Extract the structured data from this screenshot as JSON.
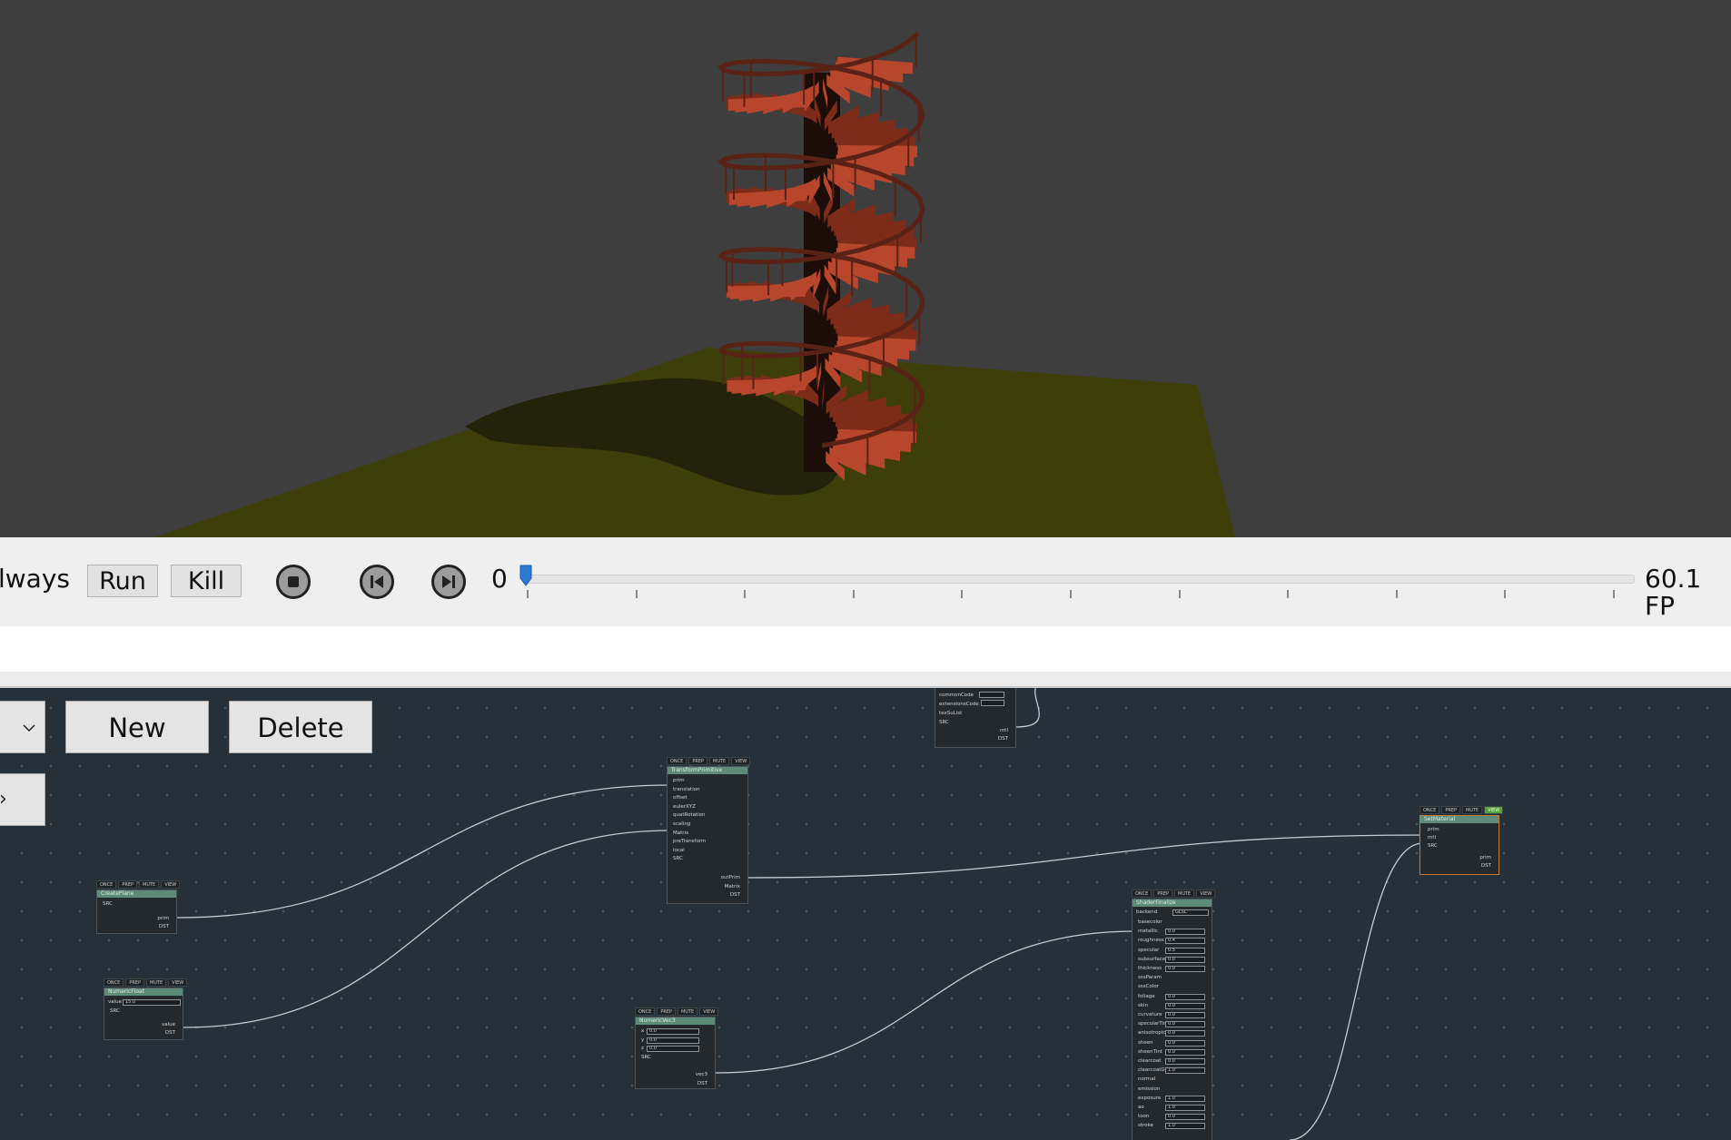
{
  "toolbar": {
    "mode_label": "lways",
    "run_label": "Run",
    "kill_label": "Kill",
    "frame_value": "0",
    "fps_label": "60.1 FP",
    "timeline_fraction": 0.0
  },
  "editor": {
    "new_label": "New",
    "delete_label": "Delete"
  },
  "flags": {
    "once": "ONCE",
    "prep": "PREP",
    "mute": "MUTE",
    "view": "VIEW"
  },
  "nodes": {
    "create_plane": {
      "title": "CreatePlane",
      "inputs": [
        "SRC"
      ],
      "outputs": [
        "prim",
        "DST"
      ]
    },
    "numeric_float": {
      "title": "NumericFloat",
      "inputs": [
        "value",
        "SRC"
      ],
      "value": "15.0",
      "outputs": [
        "value",
        "DST"
      ]
    },
    "transform_primitive": {
      "title": "TransformPrimitive",
      "inputs": [
        "prim",
        "translation",
        "offset",
        "eulerXYZ",
        "quatRotation",
        "scaling",
        "Matrix",
        "preTransform",
        "local",
        "SRC"
      ],
      "outputs": [
        "outPrim",
        "Matrix",
        "DST"
      ]
    },
    "numeric_vec3": {
      "title": "NumericVec3",
      "inputs": [
        "x",
        "y",
        "z",
        "SRC"
      ],
      "values": [
        "0.0",
        "0.0",
        "0.0"
      ],
      "outputs": [
        "vec3",
        "DST"
      ]
    },
    "shader_finalize": {
      "title": "ShaderFinalize",
      "backend_label": "backend",
      "backend_value": "GLSL",
      "inputs": [
        "basecolor",
        "metallic",
        "roughness",
        "specular",
        "subsurface",
        "thickness",
        "sssParam",
        "sssColor",
        "foliage",
        "skin",
        "curvature",
        "specularTint",
        "anisotropic",
        "sheen",
        "sheenTint",
        "clearcoat",
        "clearcoatGloss",
        "normal",
        "emission",
        "exposure",
        "ao",
        "toon",
        "stroke"
      ],
      "values": [
        "",
        "0.0",
        "0.4",
        "0.5",
        "0.0",
        "0.0",
        "",
        "",
        "0.0",
        "0.0",
        "0.0",
        "0.0",
        "0.0",
        "0.0",
        "0.0",
        "0.0",
        "1.0",
        "",
        "",
        "1.0",
        "1.0",
        "0.0",
        "1.0"
      ]
    },
    "set_material": {
      "title": "SetMaterial",
      "inputs": [
        "prim",
        "mtl",
        "SRC"
      ],
      "outputs": [
        "prim",
        "DST"
      ]
    },
    "top_node": {
      "inputs": [
        "commonCode",
        "extensionsCode",
        "texSuList",
        "SRC"
      ],
      "outputs": [
        "mtl",
        "DST"
      ]
    }
  },
  "colors": {
    "viewport_bg": "#3e3e3e",
    "ground": "#3d3e0a",
    "stairs": "#b8462c",
    "rail": "#5a2214",
    "editor_bg": "#263038",
    "node_header": "#5e8a78",
    "view_active": "#57a23a",
    "thumb": "#2a7ad6"
  }
}
